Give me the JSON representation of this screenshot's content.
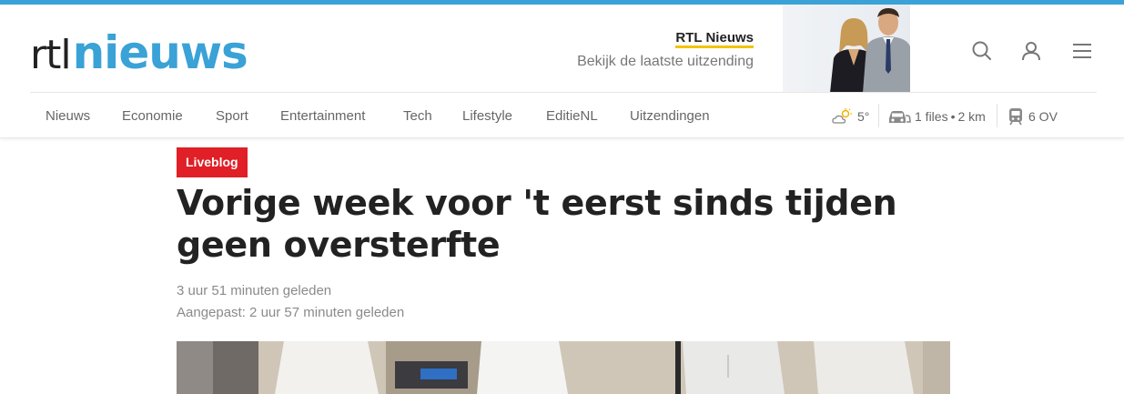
{
  "brand": {
    "logo_prefix": "rtl",
    "logo_main": "nieuws",
    "accent": "#3aa2d6"
  },
  "promo": {
    "title": "RTL Nieuws",
    "subtitle": "Bekijk de laatste uitzending"
  },
  "header_icons": [
    "search-icon",
    "user-icon",
    "menu-icon"
  ],
  "nav": {
    "items": [
      {
        "label": "Nieuws"
      },
      {
        "label": "Economie"
      },
      {
        "label": "Sport"
      },
      {
        "label": "Entertainment"
      },
      {
        "label": "Tech"
      },
      {
        "label": "Lifestyle"
      },
      {
        "label": "EditieNL"
      },
      {
        "label": "Uitzendingen"
      }
    ],
    "weather": {
      "temp": "5°"
    },
    "traffic": {
      "files": "1 files",
      "km": "2 km"
    },
    "ov": {
      "label": "6 OV"
    }
  },
  "article": {
    "badge": "Liveblog",
    "badge_color": "#e01f26",
    "headline": "Vorige week voor 't eerst sinds tijden geen oversterfte",
    "published": "3 uur 51 minuten geleden",
    "updated": "Aangepast: 2 uur 57 minuten geleden"
  }
}
